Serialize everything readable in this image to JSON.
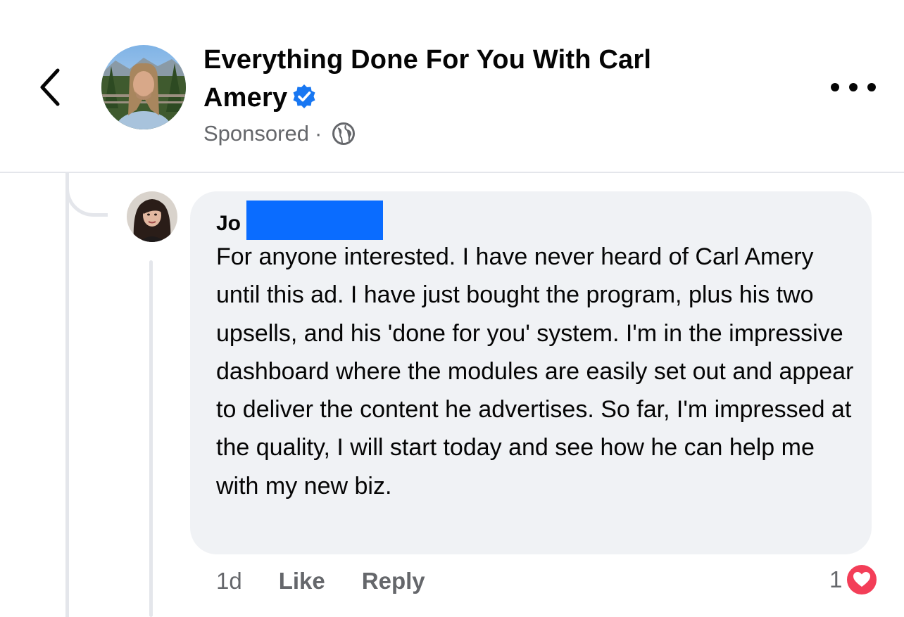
{
  "header": {
    "page_name": "Everything Done For You With Carl Amery",
    "sponsored": "Sponsored",
    "dot": "·",
    "icons": [
      "back-chevron-icon",
      "verified-badge-icon",
      "globe-icon",
      "more-options-icon"
    ],
    "accent_color": "#1877f2"
  },
  "comment": {
    "author": "Jo",
    "text": "For anyone interested. I have never heard of Carl Amery until this ad. I have just bought the program, plus his two upsells, and his 'done for you' system. I'm in the impressive dashboard where the modules are easily set out and appear to deliver the content he advertises. So far, I'm impressed at the quality, I will start today and see how he can help me with my new biz.",
    "time": "1d",
    "like_label": "Like",
    "reply_label": "Reply",
    "reaction_count": "1",
    "reaction_icon": "heart-icon",
    "reaction_color": "#f33e58",
    "redaction_color": "#0a6cff"
  }
}
